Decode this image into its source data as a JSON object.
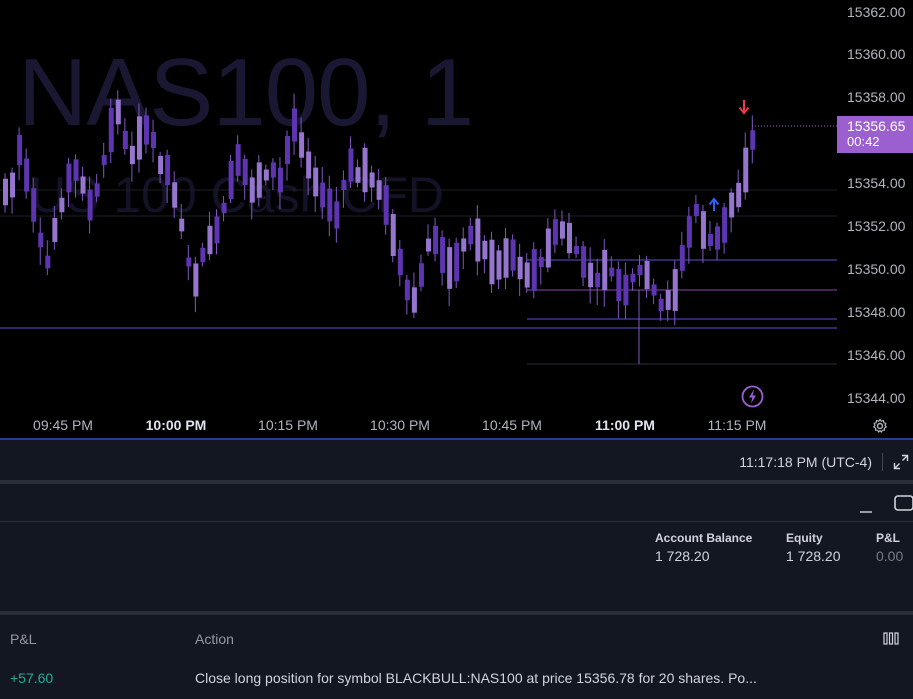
{
  "chart": {
    "symbol_watermark": "NAS100, 1",
    "description_watermark": "US 100 Cash CFD",
    "current_price": "15356.65",
    "countdown": "00:42",
    "price_ticks": [
      "15362.00",
      "15360.00",
      "15358.00",
      "15356.00",
      "15354.00",
      "15352.00",
      "15350.00",
      "15348.00",
      "15346.00",
      "15344.00"
    ],
    "time_ticks": [
      {
        "label": "09:45 PM",
        "bold": false
      },
      {
        "label": "10:00 PM",
        "bold": true
      },
      {
        "label": "10:15 PM",
        "bold": false
      },
      {
        "label": "10:30 PM",
        "bold": false
      },
      {
        "label": "10:45 PM",
        "bold": false
      },
      {
        "label": "11:00 PM",
        "bold": true
      },
      {
        "label": "11:15 PM",
        "bold": false
      }
    ],
    "candle_color": "#7e57c2",
    "price_label_color": "#9c5fd0",
    "buy_marker_color": "#2962ff",
    "sell_marker_color": "#f23645"
  },
  "status": {
    "clock": "11:17:18 PM (UTC-4)"
  },
  "account": {
    "balance_label": "Account Balance",
    "balance_value": "1 728.20",
    "equity_label": "Equity",
    "equity_value": "1 728.20",
    "pnl_label": "P&L",
    "pnl_value": "0.00"
  },
  "log": {
    "col_pnl": "P&L",
    "col_action": "Action",
    "rows": [
      {
        "pnl": "+57.60",
        "action": "Close long position for symbol BLACKBULL:NAS100 at price 15356.78 for 20 shares. Po..."
      }
    ]
  },
  "icons": {
    "settings": "gear-icon",
    "alerts": "lightning-icon",
    "expand": "expand-icon",
    "minimize": "minimize-icon",
    "maximize": "maximize-icon",
    "columns": "columns-icon"
  }
}
